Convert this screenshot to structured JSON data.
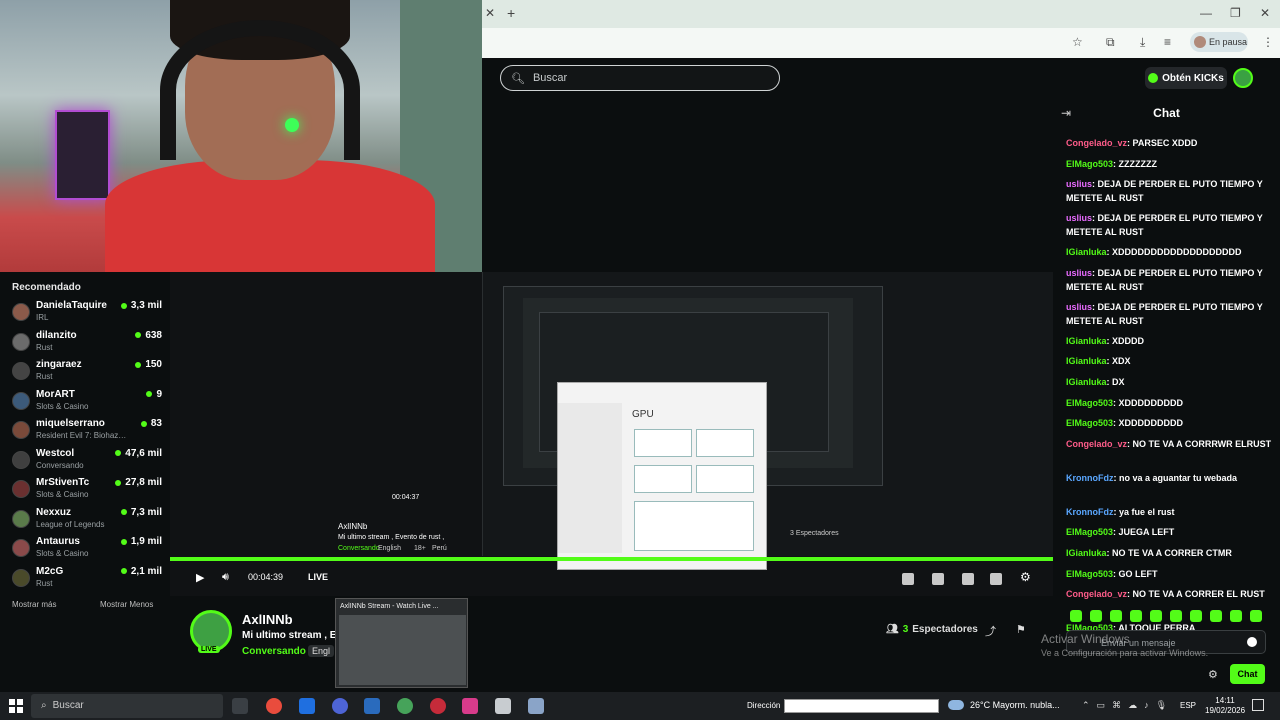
{
  "browser": {
    "paused_label": "En pausa",
    "new_tab_icon": "plus-icon",
    "close_tab_icon": "close-icon"
  },
  "site": {
    "search_placeholder": "Buscar",
    "kick_button": "Obtén KICKs",
    "accent": "#53fc18"
  },
  "sidebar": {
    "title": "Recomendado",
    "items": [
      {
        "name": "DanielaTaquire",
        "category": "IRL",
        "viewers": "3,3 mil"
      },
      {
        "name": "dilanzito",
        "category": "Rust",
        "viewers": "638"
      },
      {
        "name": "zingaraez",
        "category": "Rust",
        "viewers": "150"
      },
      {
        "name": "MorART",
        "category": "Slots & Casino",
        "viewers": "9"
      },
      {
        "name": "miquelserrano",
        "category": "Resident Evil 7: Biohaz…",
        "viewers": "83"
      },
      {
        "name": "Westcol",
        "category": "Conversando",
        "viewers": "47,6 mil"
      },
      {
        "name": "MrStivenTc",
        "category": "Slots & Casino",
        "viewers": "27,8 mil"
      },
      {
        "name": "Nexxuz",
        "category": "League of Legends",
        "viewers": "7,3 mil"
      },
      {
        "name": "Antaurus",
        "category": "Slots & Casino",
        "viewers": "1,9 mil"
      },
      {
        "name": "M2cG",
        "category": "Rust",
        "viewers": "2,1 mil"
      }
    ],
    "show_more": "Mostrar más",
    "show_less": "Mostrar Menos"
  },
  "player": {
    "time": "00:04:39",
    "live_label": "LIVE",
    "progress": 1.0,
    "nested_time": "00:04:37",
    "nested_channel": "AxlINNb",
    "nested_title": "Mi ultimo stream , Evento de rust ,",
    "nested_category": "Conversando",
    "nested_lang": "English",
    "nested_age": "18+",
    "nested_country": "Perú",
    "nested_viewers": "3 Espectadores",
    "task_manager_heading": "GPU"
  },
  "channel": {
    "name": "AxlINNb",
    "title": "Mi ultimo stream , E",
    "category": "Conversando",
    "language": "Engl",
    "live_badge": "LIVE",
    "viewers_count": "3",
    "viewers_label": "Espectadores"
  },
  "tooltip": {
    "title": "AxlINNb Stream - Watch Live ..."
  },
  "chat": {
    "title": "Chat",
    "messages": [
      {
        "user": "Congelado_vz",
        "color": "#ff5c8a",
        "text": "PARSEC XDDD"
      },
      {
        "user": "ElMago503",
        "color": "#53fc18",
        "text": "ZZZZZZZ"
      },
      {
        "user": "uslius",
        "color": "#e96bff",
        "text": "DEJA DE PERDER EL PUTO TIEMPO Y METETE AL RUST"
      },
      {
        "user": "uslius",
        "color": "#e96bff",
        "text": "DEJA DE PERDER EL PUTO TIEMPO Y METETE AL RUST"
      },
      {
        "user": "IGianluka",
        "color": "#53fc18",
        "text": "XDDDDDDDDDDDDDDDDDDD"
      },
      {
        "user": "uslius",
        "color": "#e96bff",
        "text": "DEJA DE PERDER EL PUTO TIEMPO Y METETE AL RUST"
      },
      {
        "user": "uslius",
        "color": "#e96bff",
        "text": "DEJA DE PERDER EL PUTO TIEMPO Y METETE AL RUST"
      },
      {
        "user": "IGianluka",
        "color": "#53fc18",
        "text": "XDDDD"
      },
      {
        "user": "IGianluka",
        "color": "#53fc18",
        "text": "XDX"
      },
      {
        "user": "IGianluka",
        "color": "#53fc18",
        "text": "DX"
      },
      {
        "user": "ElMago503",
        "color": "#53fc18",
        "text": "XDDDDDDDDD"
      },
      {
        "user": "ElMago503",
        "color": "#53fc18",
        "text": "XDDDDDDDDD"
      },
      {
        "user": "Congelado_vz",
        "color": "#ff5c8a",
        "text": "NO TE VA A CORRRWR ELRUST"
      },
      {
        "user": "KronnoFdz",
        "color": "#5aa7ff",
        "text": "no va a aguantar tu webada"
      },
      {
        "user": "KronnoFdz",
        "color": "#5aa7ff",
        "text": "ya fue el rust"
      },
      {
        "user": "ElMago503",
        "color": "#53fc18",
        "text": "JUEGA LEFT"
      },
      {
        "user": "IGianluka",
        "color": "#53fc18",
        "text": "NO TE VA A CORRER CTMR"
      },
      {
        "user": "ElMago503",
        "color": "#53fc18",
        "text": "GO LEFT"
      },
      {
        "user": "Congelado_vz",
        "color": "#ff5c8a",
        "text": "NO TE VA A CORRER EL RUST"
      },
      {
        "user": "ElMago503",
        "color": "#53fc18",
        "text": "ALTOQUE PERRA"
      }
    ],
    "input_placeholder": "Enviar un mensaje",
    "send_label": "Chat"
  },
  "watermark": {
    "line1": "Activar Windows",
    "line2": "Ve a Configuración para activar Windows."
  },
  "taskbar": {
    "search_placeholder": "Buscar",
    "address_label": "Dirección",
    "weather": "26°C  Mayorm. nubla...",
    "language": "ESP",
    "time": "14:11",
    "date": "19/02/2026"
  }
}
